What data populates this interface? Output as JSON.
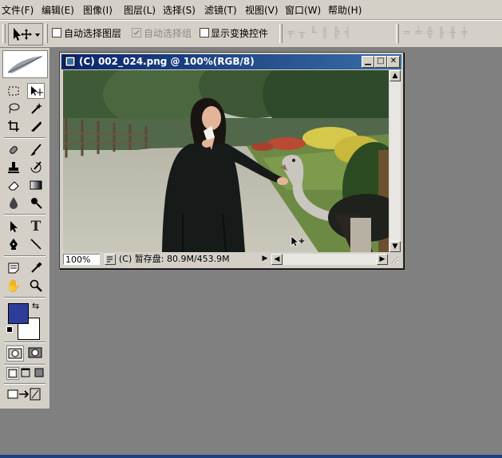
{
  "menu": {
    "items": [
      {
        "label": "文件(F)"
      },
      {
        "label": "编辑(E)"
      },
      {
        "label": "图像(I)"
      },
      {
        "label": "图层(L)"
      },
      {
        "label": "选择(S)"
      },
      {
        "label": "滤镜(T)"
      },
      {
        "label": "视图(V)"
      },
      {
        "label": "窗口(W)"
      },
      {
        "label": "帮助(H)"
      }
    ]
  },
  "options": {
    "auto_select_layer": "自动选择图层",
    "auto_select_group": "自动选择组",
    "show_transform_controls": "显示变换控件",
    "auto_select_layer_checked": false,
    "auto_select_group_checked": true,
    "show_transform_controls_checked": false
  },
  "toolbox": {
    "foreground_color": "#2c3d9a",
    "background_color": "#ffffff"
  },
  "document": {
    "title": "(C) 002_024.png @ 100%(RGB/8)",
    "zoom": "100%",
    "scratch": "(C) 暂存盘: 80.9M/453.9M",
    "scrollbar_track_color": "#e8e6e2"
  },
  "colors": {
    "workspace": "#808080",
    "chrome": "#d4d0c8",
    "titlebar_start": "#0a246a",
    "titlebar_end": "#3a6ea5"
  }
}
